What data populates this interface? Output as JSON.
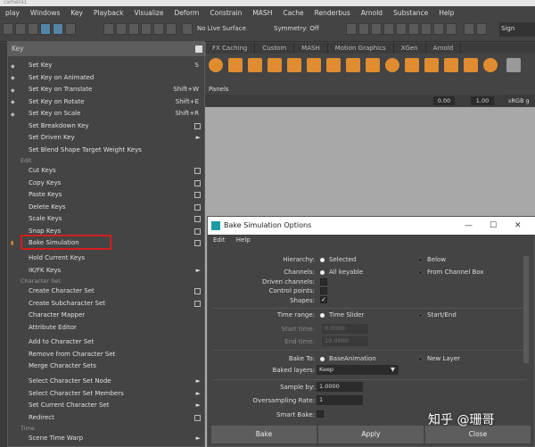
{
  "window": {
    "title": "camera1"
  },
  "menubar": [
    "play",
    "Windows",
    "Key",
    "Playback",
    "Visualize",
    "Deform",
    "Constrain",
    "MASH",
    "Cache",
    "Renderbus",
    "Arnold",
    "Substance",
    "Help"
  ],
  "toolbar": {
    "live_surface": "No Live Surface",
    "symmetry": "Symmetry: Off",
    "sign_in": "Sign"
  },
  "shelf_tabs": [
    "FX Caching",
    "Custom",
    "MASH",
    "Motion Graphics",
    "XGen",
    "Arnold"
  ],
  "panels_label": "Panels",
  "viewport": {
    "field1": "0.00",
    "field2": "1.00",
    "colorspace": "sRGB g"
  },
  "key_menu": {
    "title": "Key",
    "items": [
      {
        "label": "Set Key",
        "shortcut": "S"
      },
      {
        "label": "Set Key on Animated"
      },
      {
        "label": "Set Key on Translate",
        "shortcut": "Shift+W"
      },
      {
        "label": "Set Key on Rotate",
        "shortcut": "Shift+E"
      },
      {
        "label": "Set Key on Scale",
        "shortcut": "Shift+R"
      },
      {
        "label": "Set Breakdown Key"
      },
      {
        "label": "Set Driven Key"
      },
      {
        "label": "Set Blend Shape Target Weight Keys"
      },
      {
        "label": "Cut Keys"
      },
      {
        "label": "Copy Keys"
      },
      {
        "label": "Paste Keys"
      },
      {
        "label": "Delete Keys"
      },
      {
        "label": "Scale Keys"
      },
      {
        "label": "Snap Keys"
      },
      {
        "label": "Bake Simulation"
      },
      {
        "label": "Hold Current Keys"
      },
      {
        "label": "IK/FK Keys"
      },
      {
        "label": "Create Character Set"
      },
      {
        "label": "Create Subcharacter Set"
      },
      {
        "label": "Character Mapper"
      },
      {
        "label": "Attribute Editor"
      },
      {
        "label": "Add to Character Set"
      },
      {
        "label": "Remove from Character Set"
      },
      {
        "label": "Merge Character Sets"
      },
      {
        "label": "Select Character Set Node"
      },
      {
        "label": "Select Character Set Members"
      },
      {
        "label": "Set Current Character Set"
      },
      {
        "label": "Redirect"
      },
      {
        "label": "Scene Time Warp"
      }
    ],
    "sections": {
      "edit": "Edit",
      "character_set": "Character Set",
      "time": "Time"
    }
  },
  "dialog": {
    "title": "Bake Simulation Options",
    "menu": [
      "Edit",
      "Help"
    ],
    "labels": {
      "hierarchy": "Hierarchy:",
      "channels": "Channels:",
      "driven": "Driven channels:",
      "control_points": "Control points:",
      "shapes": "Shapes:",
      "time_range": "Time range:",
      "start_time": "Start time:",
      "end_time": "End time:",
      "bake_to": "Bake To:",
      "baked_layers": "Baked layers:",
      "sample_by": "Sample by:",
      "oversampling": "Oversampling Rate:",
      "smart_bake": "Smart Bake:"
    },
    "options": {
      "selected": "Selected",
      "below": "Below",
      "all_keyable": "All keyable",
      "from_channel_box": "From Channel Box",
      "time_slider": "Time Slider",
      "start_end": "Start/End",
      "base_animation": "BaseAnimation",
      "new_layer": "New Layer"
    },
    "values": {
      "start_time": "0.0000",
      "end_time": "10.0000",
      "baked_layers": "Keep",
      "sample_by": "1.0000",
      "oversampling": "1"
    },
    "buttons": {
      "bake": "Bake",
      "apply": "Apply",
      "close": "Close"
    }
  },
  "watermark": "知乎 @珊哥"
}
